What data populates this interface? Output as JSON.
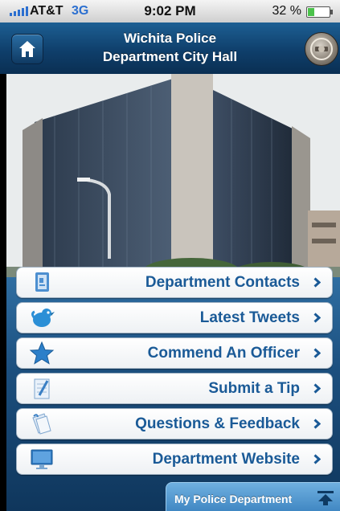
{
  "status_bar": {
    "carrier": "AT&T",
    "network": "3G",
    "time": "9:02 PM",
    "battery": "32 %",
    "battery_level": 0.32
  },
  "nav": {
    "title_line1": "Wichita Police",
    "title_line2": "Department City Hall",
    "home_icon": "home-icon",
    "badge_icon": "police-badge-icon"
  },
  "menu": [
    {
      "label": "Department Contacts",
      "icon": "contacts-book-icon"
    },
    {
      "label": "Latest Tweets",
      "icon": "twitter-bird-icon"
    },
    {
      "label": "Commend An Officer",
      "icon": "star-icon"
    },
    {
      "label": "Submit a Tip",
      "icon": "pencil-note-icon"
    },
    {
      "label": "Questions & Feedback",
      "icon": "notes-icon"
    },
    {
      "label": "Department Website",
      "icon": "monitor-icon"
    }
  ],
  "bottom_tab": {
    "label": "My Police Department",
    "icon": "expand-up-icon"
  },
  "colors": {
    "nav_blue": "#0f3f6b",
    "label_blue": "#1a5a97",
    "tab_blue": "#3f86c2"
  }
}
